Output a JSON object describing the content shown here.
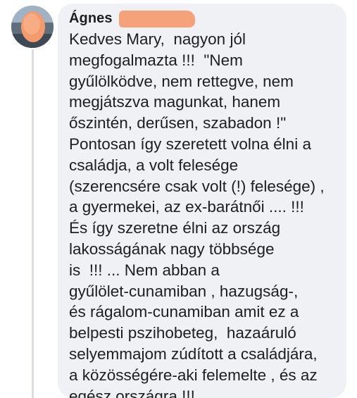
{
  "comment": {
    "author": "Ágnes",
    "lines": [
      "Kedves Mary,  nagyon jól",
      "megfogalmazta !!!  \"Nem",
      "gyűlölködve, nem rettegve, nem",
      "megjátszva magunkat, hanem",
      "őszintén, derűsen, szabadon !\"",
      "Pontosan így szeretett volna élni a",
      "családja, a volt felesége",
      "(szerencsére csak volt (!) felesége) ,",
      "a gyermekei, az ex-barátnői .... !!!",
      "És így szeretne élni az ország",
      "lakosságának nagy többsége",
      "is  !!! ... Nem abban a",
      "gyűlölet-cunamiban , hazugság-,",
      "és rágalom-cunamiban amit ez a",
      "belpesti pszihobeteg,  hazaáruló",
      "selyemmajom zúdított a családjára,",
      "a közösségére-aki felemelte , és az",
      "egész országra !!!"
    ]
  },
  "colors": {
    "bubble": "#f0f1f4",
    "text": "#1c1e21",
    "redaction": "#f5a27a"
  }
}
